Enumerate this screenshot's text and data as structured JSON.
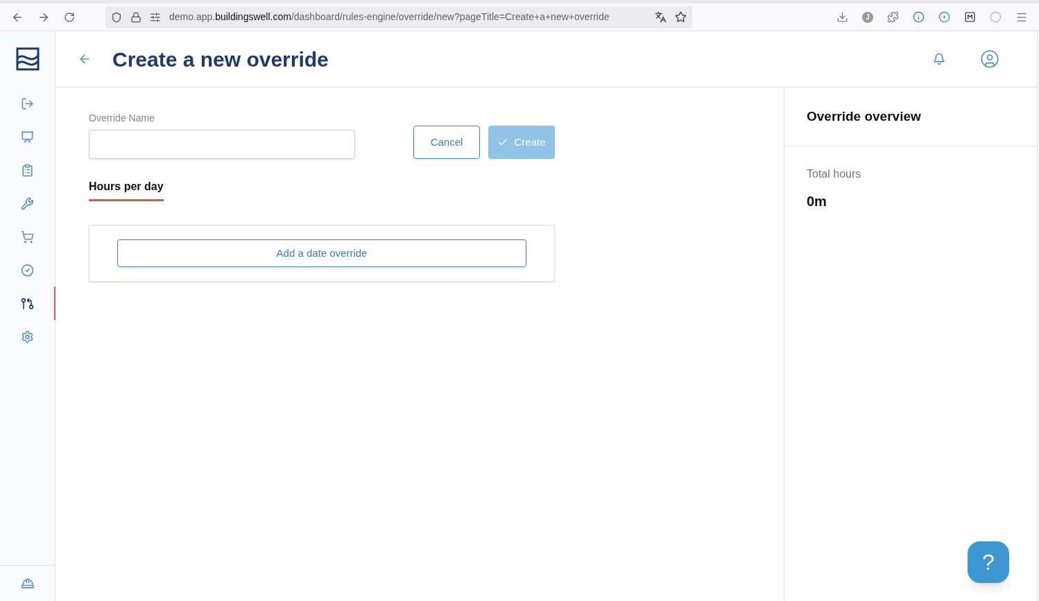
{
  "browser": {
    "url": {
      "prefix": "demo.app.",
      "host": "buildingswell.com",
      "path": "/dashboard/rules-engine/override/new?pageTitle=Create+a+new+override"
    },
    "profile_initial": "J"
  },
  "sidebar": {
    "items": [
      {
        "selected": false
      },
      {
        "selected": false
      },
      {
        "selected": false
      },
      {
        "selected": false
      },
      {
        "selected": false
      },
      {
        "selected": false
      },
      {
        "selected": true
      },
      {
        "selected": false
      }
    ]
  },
  "header": {
    "title": "Create a new override"
  },
  "form": {
    "name_label": "Override Name",
    "cancel": "Cancel",
    "create": {
      "label": "Create",
      "disabled": true
    }
  },
  "tabs": [
    {
      "label": "Hours per day",
      "selected": true
    }
  ],
  "add_button": "Add a date override",
  "overview": {
    "title": "Override overview",
    "total_label": "Total hours",
    "total_value": "0m"
  },
  "help": "?"
}
